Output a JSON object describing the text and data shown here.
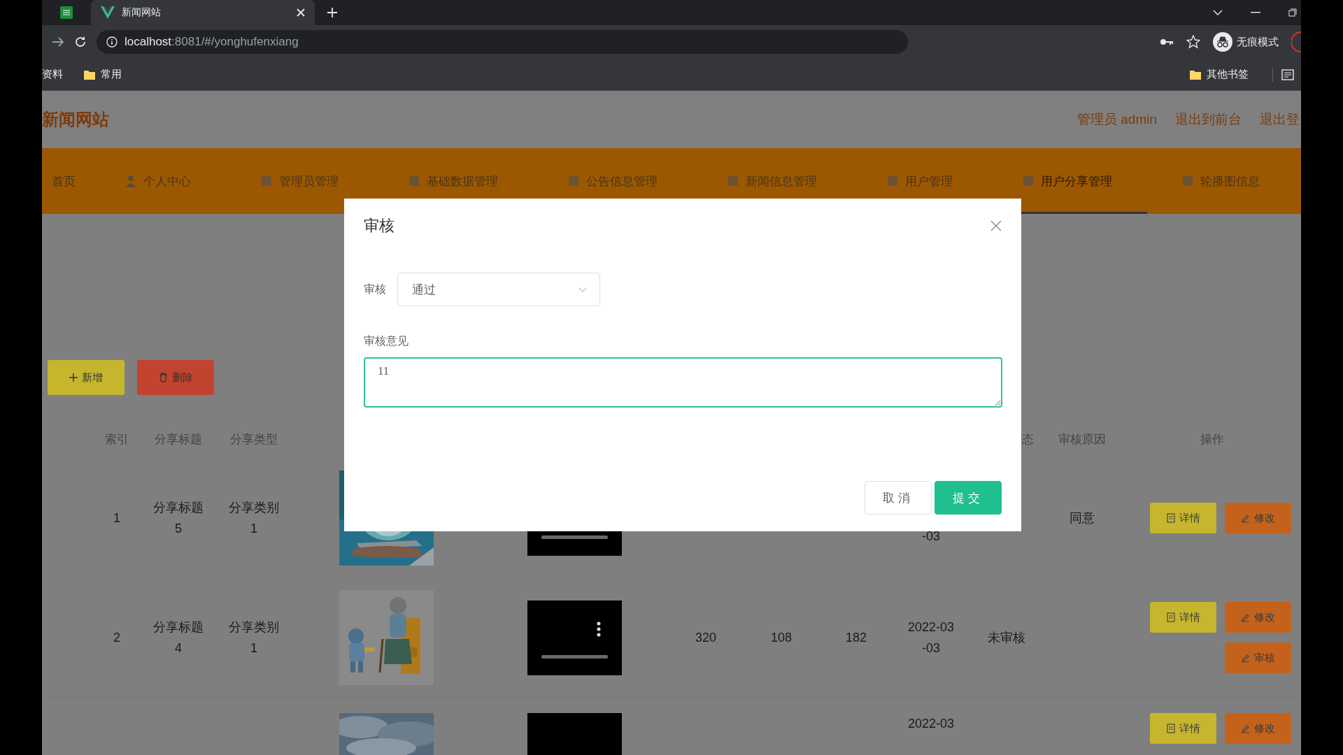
{
  "browser": {
    "tabs": [
      {
        "kind": "pinned",
        "selected": false
      },
      {
        "kind": "page",
        "title": "新闻网站",
        "selected": true
      }
    ],
    "url_host": "localhost",
    "url_rest": ":8081/#/yonghufenxiang",
    "profile_label": "无痕模式",
    "bookmarks": [
      "资料",
      "常用"
    ],
    "other_bookmarks": "其他书签"
  },
  "header": {
    "site_title": "新闻网站",
    "links": [
      "管理员 admin",
      "退出到前台",
      "退出登"
    ]
  },
  "nav": [
    {
      "label": "首页",
      "selected": false
    },
    {
      "label": "个人中心",
      "selected": false
    },
    {
      "label": "管理员管理",
      "selected": false
    },
    {
      "label": "基础数据管理",
      "selected": false
    },
    {
      "label": "公告信息管理",
      "selected": false
    },
    {
      "label": "新闻信息管理",
      "selected": false
    },
    {
      "label": "用户管理",
      "selected": false
    },
    {
      "label": "用户分享管理",
      "selected": true
    },
    {
      "label": "轮播图信息",
      "selected": false
    }
  ],
  "toolbar": [
    {
      "label": "新增",
      "kind": "add"
    },
    {
      "label": "删除",
      "kind": "delete"
    }
  ],
  "table": {
    "columns": [
      "索引",
      "分享标题",
      "分享类型",
      "态",
      "审核原因",
      "操作"
    ],
    "rows": [
      {
        "index": "1",
        "title": "分享标题5",
        "type": "分享类别1",
        "date": "-03",
        "reason": "同意",
        "actions": [
          {
            "label": "详情",
            "kind": "detail"
          },
          {
            "label": "修改",
            "kind": "edit"
          }
        ]
      },
      {
        "index": "2",
        "title": "分享标题4",
        "type": "分享类别1",
        "column_6": "320",
        "column_7": "108",
        "column_8": "182",
        "date": "2022-03-03",
        "status": "未审核",
        "actions": [
          {
            "label": "详情",
            "kind": "detail"
          },
          {
            "label": "修改",
            "kind": "edit"
          },
          {
            "label": "审核",
            "kind": "review"
          }
        ]
      },
      {
        "date": "2022-03",
        "actions": [
          {
            "label": "详情",
            "kind": "detail"
          },
          {
            "label": "修改",
            "kind": "edit"
          }
        ]
      }
    ]
  },
  "dialog": {
    "title": "审核",
    "fields": [
      {
        "kind": "select",
        "label": "审核",
        "value": "通过"
      },
      {
        "kind": "textarea",
        "label": "审核意见",
        "value": "11"
      }
    ],
    "buttons": [
      {
        "label": "取消",
        "kind": "cancel"
      },
      {
        "label": "提交",
        "kind": "primary"
      }
    ]
  }
}
